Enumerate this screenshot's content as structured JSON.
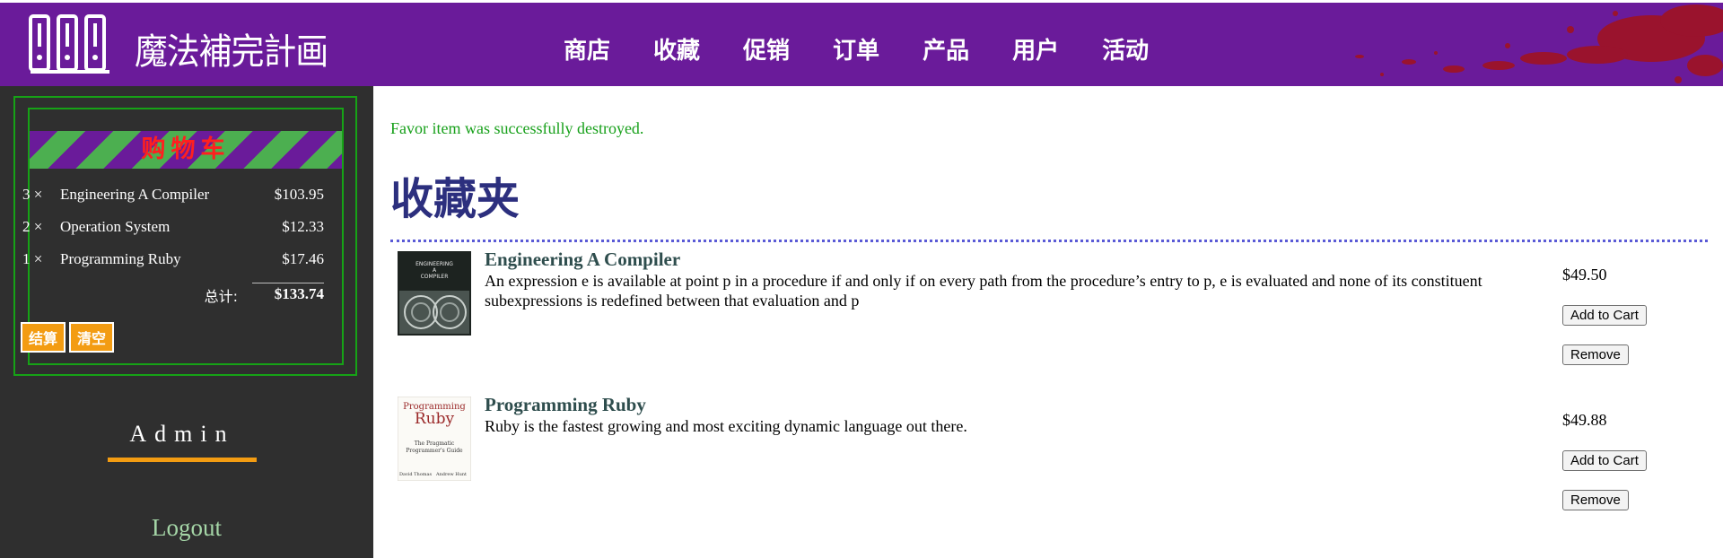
{
  "header": {
    "logo_text": "魔法補完計画",
    "nav": [
      "商店",
      "收藏",
      "促销",
      "订单",
      "产品",
      "用户",
      "活动"
    ]
  },
  "cart": {
    "title": "购物车",
    "items": [
      {
        "qty": "3 ×",
        "title": "Engineering A Compiler",
        "price": "$103.95"
      },
      {
        "qty": "2 ×",
        "title": "Operation System",
        "price": "$12.33"
      },
      {
        "qty": "1 ×",
        "title": "Programming Ruby",
        "price": "$17.46"
      }
    ],
    "total_label": "总计:",
    "total": "$133.74",
    "checkout_label": "结算",
    "empty_label": "清空"
  },
  "user": {
    "name": "Admin",
    "logout_label": "Logout"
  },
  "main": {
    "notice": "Favor item was successfully destroyed.",
    "title": "收藏夹",
    "items": [
      {
        "title": "Engineering A Compiler",
        "description": "An expression e is available at point p in a procedure if and only if on every path from the procedure’s entry to p, e is evaluated and none of its constituent subexpressions is redefined between that evaluation and p",
        "price": "$49.50",
        "add_label": "Add to Cart",
        "remove_label": "Remove",
        "cover_text": [
          "ENGINEERING",
          "A",
          "COMPILER"
        ]
      },
      {
        "title": "Programming Ruby",
        "description": "Ruby is the fastest growing and most exciting dynamic language out there.",
        "price": "$49.88",
        "add_label": "Add to Cart",
        "remove_label": "Remove",
        "cover_text": [
          "Programming",
          "Ruby",
          "The Pragmatic",
          "Programmer's Guide",
          "David Thomas",
          "Andrew Hunt"
        ]
      }
    ]
  },
  "colors": {
    "header_bg": "#6a1b9a",
    "sidebar_bg": "#2f2f2f",
    "cart_border": "#16a316",
    "button_orange": "#f39c12",
    "notice_green": "#17a01a",
    "title_navy": "#2c2f7e"
  }
}
